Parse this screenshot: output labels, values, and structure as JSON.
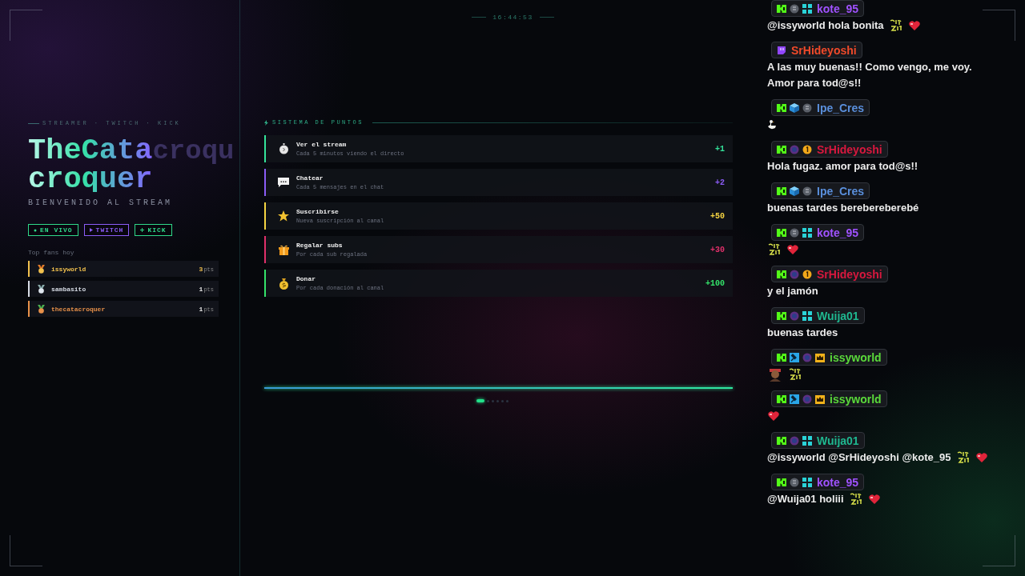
{
  "clock": "16:44:53",
  "left": {
    "tagline": "STREAMER · TWITCH · KICK",
    "title_lines": [
      "TheCata",
      "croquer"
    ],
    "title_echo": "croqu",
    "welcome": "BIENVENIDO AL STREAM",
    "tags": [
      {
        "label": "EN VIVO",
        "kind": "dot",
        "color": "#2fd98a"
      },
      {
        "label": "TWITCH",
        "kind": "play",
        "color": "#8b5cf6"
      },
      {
        "label": "KICK",
        "kind": "plus",
        "color": "#2fd98a"
      }
    ],
    "fans_title": "Top fans hoy",
    "fans": [
      {
        "name": "issyworld",
        "points": "3",
        "unit": "pts",
        "color": "#f2c14e",
        "kind": "gold"
      },
      {
        "name": "sambasito",
        "points": "1",
        "unit": "pts",
        "color": "#d8dde6",
        "kind": "silver"
      },
      {
        "name": "thecatacroquer",
        "points": "1",
        "unit": "pts",
        "color": "#e8914a",
        "kind": "bronze"
      }
    ]
  },
  "points": {
    "title": "SISTEMA DE PUNTOS",
    "rows": [
      {
        "kind": "stopwatch",
        "title": "Ver el stream",
        "subtitle": "Cada 5 minutos viendo el directo",
        "points": "+1",
        "color": "#34e39a"
      },
      {
        "kind": "chat",
        "title": "Chatear",
        "subtitle": "Cada 5 mensajes en el chat",
        "points": "+2",
        "color": "#8b5cf6"
      },
      {
        "kind": "star",
        "title": "Suscribirse",
        "subtitle": "Nueva suscripción al canal",
        "points": "+50",
        "color": "#f5d442"
      },
      {
        "kind": "gift",
        "title": "Regalar subs",
        "subtitle": "Por cada sub regalada",
        "points": "+30",
        "color": "#e0306a"
      },
      {
        "kind": "bag",
        "title": "Donar",
        "subtitle": "Por cada donación al canal",
        "points": "+100",
        "color": "#34e36a"
      }
    ],
    "progress": {
      "level": 1
    },
    "pages": [
      {
        "selected": true
      },
      {
        "selected": false
      },
      {
        "selected": false
      },
      {
        "selected": false
      },
      {
        "selected": false
      },
      {
        "selected": false
      }
    ]
  },
  "chat": [
    {
      "user": "kote_95",
      "color": "#a052ff",
      "badges": [
        {
          "kind": "kick"
        },
        {
          "kind": "round"
        },
        {
          "kind": "grid"
        }
      ],
      "text": "@issyworld hola bonita",
      "emotes": [
        {
          "kind": "sate"
        },
        {
          "kind": "heart"
        }
      ]
    },
    {
      "user": "SrHideyoshi",
      "color": "#f04a2a",
      "badges": [
        {
          "kind": "twitch"
        }
      ],
      "text": "A las muy buenas!! Como vengo, me voy. Amor para tod@s!!"
    },
    {
      "user": "Ipe_Cres",
      "color": "#5a8fdc",
      "badges": [
        {
          "kind": "kick"
        },
        {
          "kind": "cube"
        },
        {
          "kind": "round"
        }
      ],
      "emotes": [
        {
          "kind": "bird"
        }
      ]
    },
    {
      "user": "SrHideyoshi",
      "color": "#d8183e",
      "badges": [
        {
          "kind": "kick"
        },
        {
          "kind": "round-alt"
        },
        {
          "kind": "coin"
        }
      ],
      "text": "Hola fugaz. amor para tod@s!!"
    },
    {
      "user": "Ipe_Cres",
      "color": "#5a8fdc",
      "badges": [
        {
          "kind": "kick"
        },
        {
          "kind": "cube"
        },
        {
          "kind": "round"
        }
      ],
      "text": "buenas tardes berebereberebé"
    },
    {
      "user": "kote_95",
      "color": "#a052ff",
      "badges": [
        {
          "kind": "kick"
        },
        {
          "kind": "round"
        },
        {
          "kind": "grid"
        }
      ],
      "emotes": [
        {
          "kind": "sate"
        },
        {
          "kind": "heart"
        }
      ]
    },
    {
      "user": "SrHideyoshi",
      "color": "#d8183e",
      "badges": [
        {
          "kind": "kick"
        },
        {
          "kind": "round-alt"
        },
        {
          "kind": "coin"
        }
      ],
      "text": "y el jamón"
    },
    {
      "user": "Wuija01",
      "color": "#1fb890",
      "badges": [
        {
          "kind": "kick"
        },
        {
          "kind": "round-alt"
        },
        {
          "kind": "grid"
        }
      ],
      "text": "buenas tardes"
    },
    {
      "user": "issyworld",
      "color": "#5ad83a",
      "badges": [
        {
          "kind": "kick"
        },
        {
          "kind": "hammer"
        },
        {
          "kind": "round-alt"
        },
        {
          "kind": "crown"
        }
      ],
      "emotes": [
        {
          "kind": "figure"
        },
        {
          "kind": "sate"
        }
      ]
    },
    {
      "user": "issyworld",
      "color": "#5ad83a",
      "badges": [
        {
          "kind": "kick"
        },
        {
          "kind": "hammer"
        },
        {
          "kind": "round-alt"
        },
        {
          "kind": "crown"
        }
      ],
      "emotes": [
        {
          "kind": "heart"
        }
      ]
    },
    {
      "user": "Wuija01",
      "color": "#1fb890",
      "badges": [
        {
          "kind": "kick"
        },
        {
          "kind": "round-alt"
        },
        {
          "kind": "grid"
        }
      ],
      "text": "@issyworld @SrHideyoshi @kote_95",
      "emotes": [
        {
          "kind": "sate"
        },
        {
          "kind": "heart"
        }
      ]
    },
    {
      "user": "kote_95",
      "color": "#a052ff",
      "badges": [
        {
          "kind": "kick"
        },
        {
          "kind": "round"
        },
        {
          "kind": "grid"
        }
      ],
      "text": "@Wuija01 holiii",
      "emotes": [
        {
          "kind": "sate"
        },
        {
          "kind": "heart"
        }
      ]
    }
  ]
}
